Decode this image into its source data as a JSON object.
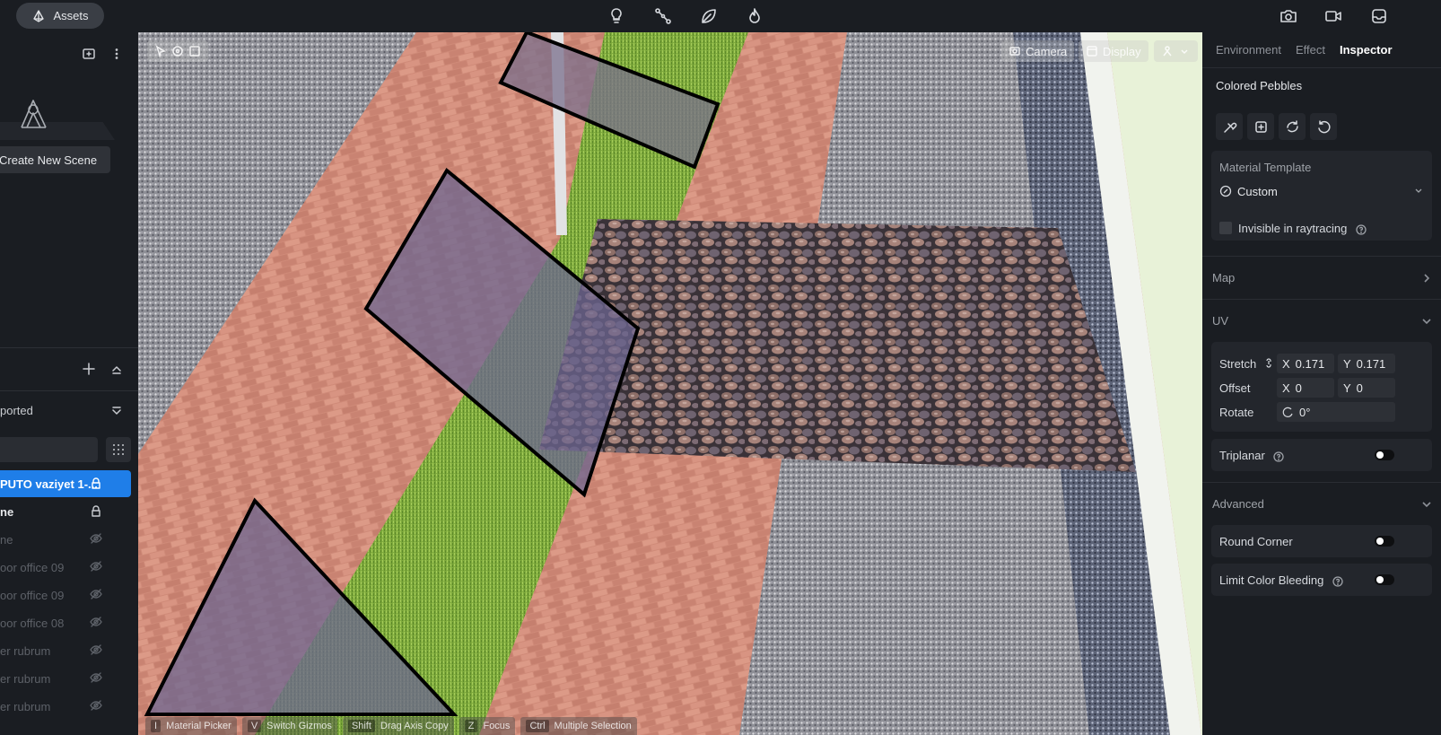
{
  "topbar": {
    "assets_label": "Assets",
    "icons": [
      "lightbulb-icon",
      "path-icon",
      "leaf-icon",
      "flame-icon",
      "camera-icon",
      "video-icon",
      "inbox-icon"
    ]
  },
  "left_panel": {
    "create_scene_label": "Create New Scene",
    "group_label": "ported",
    "layers": [
      {
        "label": "PUTO vaziyet 1-...",
        "state": "selected",
        "icon": "lock-icon"
      },
      {
        "label": "ne",
        "state": "visible",
        "icon": "lock-icon"
      },
      {
        "label": "ne",
        "state": "hidden",
        "icon": "eye-off-icon"
      },
      {
        "label": "oor office 09",
        "state": "hidden",
        "icon": "eye-off-icon"
      },
      {
        "label": "oor office 09",
        "state": "hidden",
        "icon": "eye-off-icon"
      },
      {
        "label": "oor office 08",
        "state": "hidden",
        "icon": "eye-off-icon"
      },
      {
        "label": "er rubrum",
        "state": "hidden",
        "icon": "eye-off-icon"
      },
      {
        "label": "er rubrum",
        "state": "hidden",
        "icon": "eye-off-icon"
      },
      {
        "label": "er rubrum",
        "state": "hidden",
        "icon": "eye-off-icon"
      }
    ]
  },
  "viewport": {
    "camera_label": "Camera",
    "display_label": "Display",
    "shortcuts": [
      {
        "key": "I",
        "label": "Material Picker"
      },
      {
        "key": "V",
        "label": "Switch Gizmos"
      },
      {
        "key": "Shift",
        "label": "Drag Axis Copy"
      },
      {
        "key": "Z",
        "label": "Focus"
      },
      {
        "key": "Ctrl",
        "label": "Multiple Selection"
      }
    ]
  },
  "inspector": {
    "tabs": [
      {
        "label": "Environment",
        "active": false
      },
      {
        "label": "Effect",
        "active": false
      },
      {
        "label": "Inspector",
        "active": true
      }
    ],
    "material_name": "Colored Pebbles",
    "material_template_label": "Material Template",
    "material_template_value": "Custom",
    "invisible_raytracing_label": "Invisible in raytracing",
    "map_label": "Map",
    "uv_label": "UV",
    "stretch_label": "Stretch",
    "stretch_x_axis": "X",
    "stretch_x": "0.171",
    "stretch_y_axis": "Y",
    "stretch_y": "0.171",
    "offset_label": "Offset",
    "offset_x_axis": "X",
    "offset_x": "0",
    "offset_y_axis": "Y",
    "offset_y": "0",
    "rotate_label": "Rotate",
    "rotate_value": "0°",
    "triplanar_label": "Triplanar",
    "advanced_label": "Advanced",
    "round_corner_label": "Round Corner",
    "limit_color_bleeding_label": "Limit Color Bleeding"
  }
}
